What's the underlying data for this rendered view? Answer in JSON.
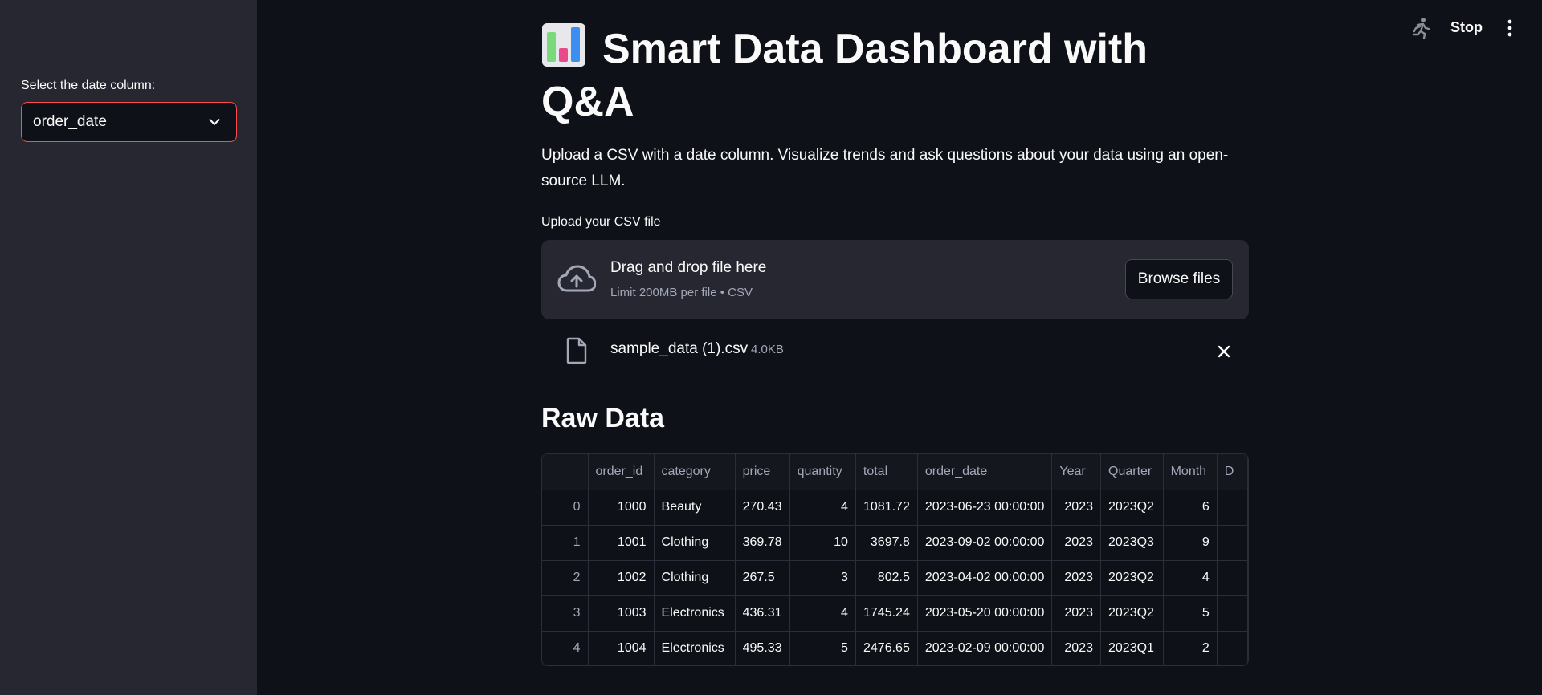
{
  "sidebar": {
    "label": "Select the date column:",
    "selected": "order_date"
  },
  "header": {
    "stop_label": "Stop"
  },
  "main": {
    "title": "Smart Data Dashboard with Q&A",
    "description": "Upload a CSV with a date column. Visualize trends and ask questions about your data using an open-source LLM.",
    "upload_label": "Upload your CSV file",
    "dropzone": {
      "title": "Drag and drop file here",
      "subtitle": "Limit 200MB per file • CSV",
      "browse_label": "Browse files"
    },
    "file": {
      "name": "sample_data (1).csv",
      "size": "4.0KB"
    },
    "section_title": "Raw Data",
    "table": {
      "columns": [
        "",
        "order_id",
        "category",
        "price",
        "quantity",
        "total",
        "order_date",
        "Year",
        "Quarter",
        "Month",
        "D"
      ],
      "rows": [
        [
          "0",
          "1000",
          "Beauty",
          "270.43",
          "4",
          "1081.72",
          "2023-06-23 00:00:00",
          "2023",
          "2023Q2",
          "6",
          ""
        ],
        [
          "1",
          "1001",
          "Clothing",
          "369.78",
          "10",
          "3697.8",
          "2023-09-02 00:00:00",
          "2023",
          "2023Q3",
          "9",
          ""
        ],
        [
          "2",
          "1002",
          "Clothing",
          "267.5",
          "3",
          "802.5",
          "2023-04-02 00:00:00",
          "2023",
          "2023Q2",
          "4",
          ""
        ],
        [
          "3",
          "1003",
          "Electronics",
          "436.31",
          "4",
          "1745.24",
          "2023-05-20 00:00:00",
          "2023",
          "2023Q2",
          "5",
          ""
        ],
        [
          "4",
          "1004",
          "Electronics",
          "495.33",
          "5",
          "2476.65",
          "2023-02-09 00:00:00",
          "2023",
          "2023Q1",
          "2",
          ""
        ]
      ]
    }
  },
  "colors": {
    "background": "#0e1117",
    "sidebar": "#262730",
    "accent": "#ff4b4b",
    "muted_text": "#a3a8b8"
  }
}
